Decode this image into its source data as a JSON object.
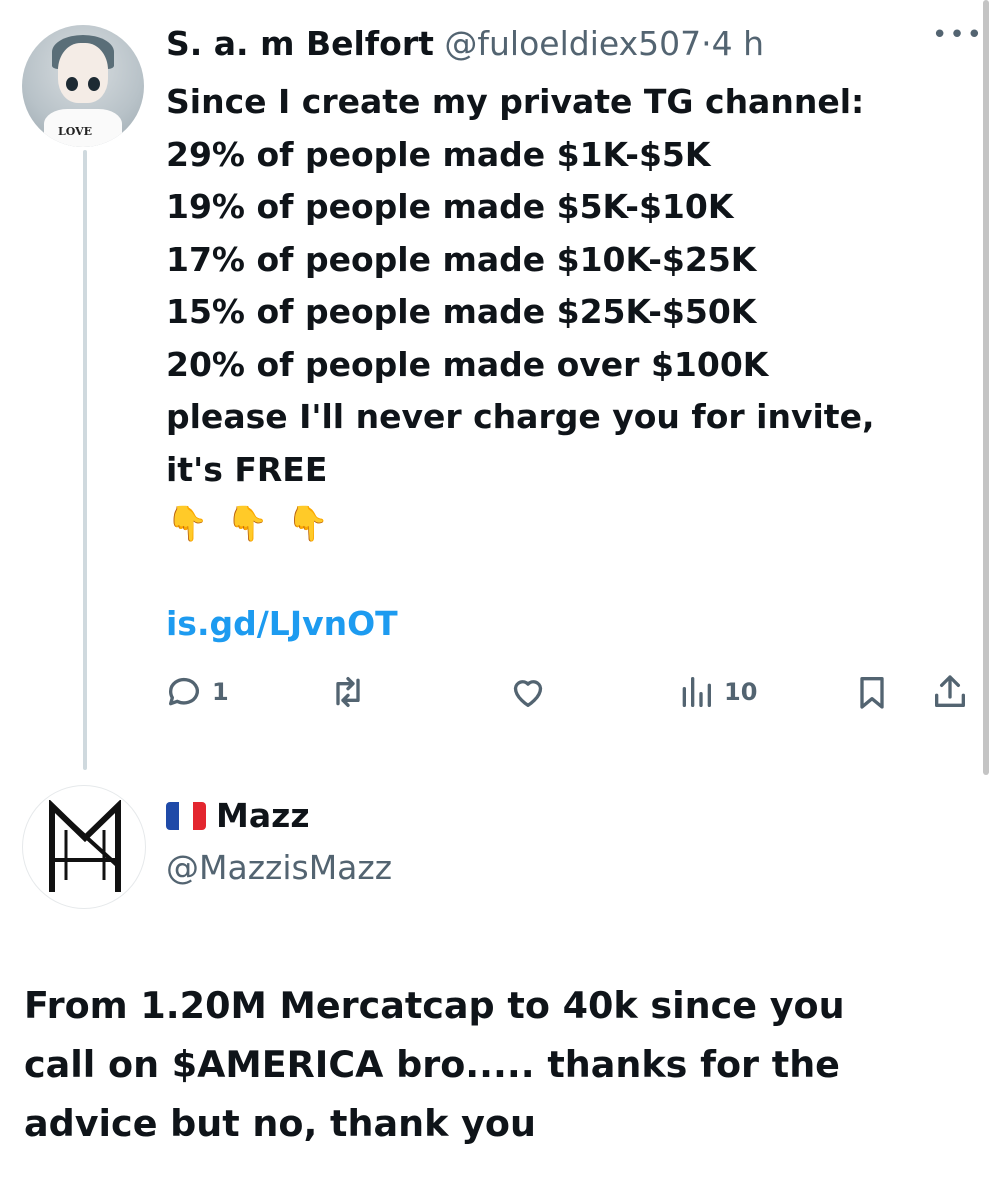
{
  "tweet": {
    "author_name": "S. a. m Belfort",
    "author_handle": "@fuloeldiex507",
    "separator": "·",
    "time": "4 h",
    "avatar_text": "LOVE",
    "more_icon": "ellipsis-icon",
    "lines": [
      "Since I create my private TG channel:",
      "29% of people made $1K-$5K",
      "19% of people made $5K-$10K",
      "17% of people made $10K-$25K",
      "15% of people made $25K-$50K",
      "20% of people made over $100K",
      "please I'll never charge you for invite,",
      "it's FREE"
    ],
    "emojis": [
      "👇",
      "👇",
      "👇"
    ],
    "link": "is.gd/LJvnOT",
    "actions": {
      "reply_count": "1",
      "retweet_count": "",
      "like_count": "",
      "views_count": "10"
    }
  },
  "reply": {
    "flag": "france-flag",
    "author_name": "Mazz",
    "author_handle": "@MazzisMazz",
    "lines": [
      "From 1.20M Mercatcap to 40k since you",
      "call on $AMERICA bro..... thanks for the",
      "advice but no, thank you"
    ]
  },
  "colors": {
    "text": "#0f1419",
    "secondary": "#536471",
    "link": "#1d9bf0",
    "thread_line": "#cfd9de"
  }
}
